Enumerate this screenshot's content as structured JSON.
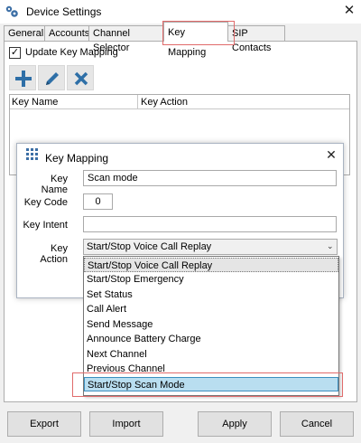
{
  "window": {
    "title": "Device Settings",
    "icon": "gear-cluster-icon",
    "close_icon": "close-icon"
  },
  "tabs": [
    {
      "label": "General"
    },
    {
      "label": "Accounts"
    },
    {
      "label": "Channel Selector"
    },
    {
      "label": "Key Mapping",
      "active": true
    },
    {
      "label": "SIP Contacts"
    }
  ],
  "update_mapping": {
    "label": "Update Key Mapping",
    "checked": true,
    "check_glyph": "✓"
  },
  "toolbar": {
    "add_icon": "plus-icon",
    "edit_icon": "pencil-icon",
    "delete_icon": "x-icon",
    "accent": "#2e6fa7"
  },
  "grid": {
    "columns": [
      "Key Name",
      "Key Action"
    ]
  },
  "dialog": {
    "title": "Key Mapping",
    "icon": "keypad-icon",
    "close_glyph": "✕",
    "key_name": {
      "label": "Key Name",
      "value": "Scan mode"
    },
    "key_code": {
      "label": "Key Code",
      "value": "0"
    },
    "key_intent": {
      "label": "Key Intent",
      "value": ""
    },
    "key_action": {
      "label": "Key Action",
      "value": "Start/Stop Voice Call Replay",
      "chevron": "⌄"
    }
  },
  "dropdown": {
    "options": [
      "Start/Stop Voice Call Replay",
      "Start/Stop Emergency",
      "Set Status",
      "Call Alert",
      "Send Message",
      "Announce Battery Charge",
      "Next Channel",
      "Previous Channel",
      "Start/Stop Scan Mode"
    ],
    "selected_index": 0,
    "hover_index": 8
  },
  "buttons": {
    "export": "Export",
    "import": "Import",
    "apply": "Apply",
    "cancel": "Cancel"
  }
}
